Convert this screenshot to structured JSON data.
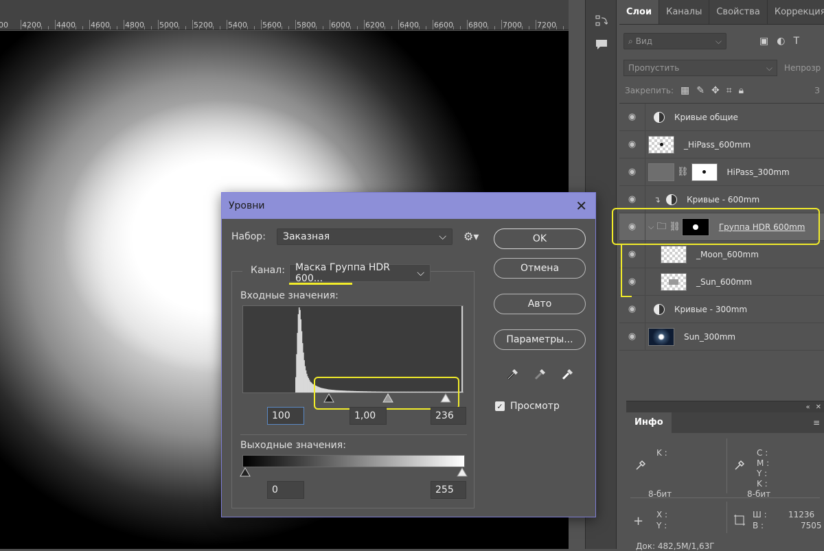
{
  "ruler": {
    "ticks": [
      "4200",
      "4400",
      "4600",
      "4800",
      "5000",
      "5200",
      "5400",
      "5600",
      "5800",
      "6000",
      "6200",
      "6400",
      "6600",
      "6800",
      "7000",
      "7200"
    ],
    "first_partial": "00"
  },
  "layers_panel": {
    "tabs": [
      "Слои",
      "Каналы",
      "Свойства",
      "Коррекция"
    ],
    "search_placeholder": "Вид",
    "blend_mode": "Пропустить",
    "opacity_label": "Непрозр",
    "lock_label": "Закрепить:",
    "fill_label": "З",
    "layers": [
      {
        "name": "Кривые общие",
        "type": "adjustment"
      },
      {
        "name": "_HiPass_600mm",
        "type": "pixel"
      },
      {
        "name": "HiPass_300mm",
        "type": "pixel-mask"
      },
      {
        "name": "Кривые - 600mm",
        "type": "adjustment-clipped"
      },
      {
        "name": "Группа HDR 600mm",
        "type": "group"
      },
      {
        "name": "_Moon_600mm",
        "type": "pixel-child"
      },
      {
        "name": "_Sun_600mm",
        "type": "pixel-child"
      },
      {
        "name": "Кривые - 300mm",
        "type": "adjustment"
      },
      {
        "name": "Sun_300mm",
        "type": "pixel-space"
      }
    ]
  },
  "info_panel": {
    "tab": "Инфо",
    "k_label": "K :",
    "bit_left": "8-бит",
    "cmyk_labels": [
      "C :",
      "M :",
      "Y :",
      "K :"
    ],
    "bit_right": "8-бит",
    "x_label": "X :",
    "y_label": "Y :",
    "w_label": "Ш :",
    "h_label": "В :",
    "w_value": "11236",
    "h_value": "7505",
    "doc": "Док: 482,5M/1,63Г"
  },
  "dialog": {
    "title": "Уровни",
    "preset_label": "Набор:",
    "preset_value": "Заказная",
    "channel_label": "Канал:",
    "channel_value": "Маска Группа HDR 600...",
    "input_label": "Входные значения:",
    "input_black": "100",
    "input_gamma": "1,00",
    "input_white": "236",
    "output_label": "Выходные значения:",
    "output_black": "0",
    "output_white": "255",
    "buttons": {
      "ok": "OK",
      "cancel": "Отмена",
      "auto": "Авто",
      "options": "Параметры..."
    },
    "preview_label": "Просмотр",
    "preview_checked": true,
    "histogram_levels": [
      0,
      0,
      0,
      0,
      0,
      0,
      0,
      0,
      0,
      0,
      0,
      0,
      0,
      0,
      0,
      0,
      0,
      0,
      0,
      0,
      0,
      0,
      0,
      0,
      0,
      0,
      0,
      0,
      0,
      0,
      0,
      0,
      0,
      0,
      0,
      0,
      0,
      0,
      0,
      0,
      0,
      0,
      0,
      0,
      0,
      0,
      0,
      0,
      0,
      0,
      0,
      0,
      0,
      0,
      0,
      0,
      0,
      0,
      0,
      0,
      0,
      0,
      0.18,
      0.45,
      0.7,
      0.92,
      1,
      0.97,
      0.86,
      0.72,
      0.58,
      0.47,
      0.38,
      0.31,
      0.26,
      0.22,
      0.19,
      0.17,
      0.15,
      0.13,
      0.12,
      0.11,
      0.1,
      0.095,
      0.09,
      0.085,
      0.08,
      0.075,
      0.07,
      0.066,
      0.062,
      0.058,
      0.055,
      0.052,
      0.05,
      0.048,
      0.046,
      0.044,
      0.042,
      0.04,
      0.038,
      0.036,
      0.035,
      0.034,
      0.033,
      0.032,
      0.031,
      0.03,
      0.029,
      0.028,
      0.027,
      0.026,
      0.026,
      0.025,
      0.025,
      0.024,
      0.024,
      0.023,
      0.023,
      0.022,
      0.022,
      0.021,
      0.021,
      0.02,
      0.02,
      0.02,
      0.019,
      0.019,
      0.018,
      0.018,
      0.018,
      0.017,
      0.017,
      0.017,
      0.016,
      0.016,
      0.016,
      0.016,
      0.015,
      0.015,
      0.015,
      0.015,
      0.014,
      0.014,
      0.014,
      0.014,
      0.014,
      0.013,
      0.013,
      0.013,
      0.013,
      0.013,
      0.012,
      0.012,
      0.012,
      0.012,
      0.012,
      0.012,
      0.011,
      0.011,
      0.011,
      0.011,
      0.011,
      0.011,
      0.011,
      0.01,
      0.01,
      0.01,
      0.01,
      0.01,
      0.01,
      0.01,
      0.01,
      0.01,
      0.01,
      0.01,
      0.01,
      0.01,
      0.01,
      0.01,
      0.01,
      0.01,
      0.01,
      0.01,
      0.01,
      0.01,
      0.01,
      0.01,
      0.01,
      0.01,
      0.01,
      0.01,
      0.01,
      0.01,
      0.01,
      0.01,
      0.01,
      0.01,
      0.01,
      0.01,
      0.01,
      0.01,
      0.01,
      0.01,
      0.01,
      0.01,
      0.01,
      0.01,
      0.01,
      0.01,
      0.01,
      0.01,
      0.01,
      0.01,
      0.01,
      0.01,
      0.01,
      0.01,
      0.01,
      0.01,
      0.01,
      0.01,
      0.01,
      0.01,
      0.01,
      0.01,
      0.01,
      0.01,
      0.01,
      0.01,
      0.01,
      0.01,
      0.01,
      0.01,
      0.01,
      0.01,
      0.01,
      0.01,
      0.01,
      0.01,
      0.01,
      0.01,
      0.01,
      0.01,
      0.01,
      0.01,
      0.01,
      0.01,
      0.01,
      0.01,
      0.01,
      0.01,
      0.01,
      0.01,
      0.01,
      0.01,
      0.01,
      0.01,
      0.01,
      0.01,
      0.01
    ]
  },
  "colors": {
    "dialog_title": "#8d8fd8",
    "highlight": "#f2ec2a"
  }
}
